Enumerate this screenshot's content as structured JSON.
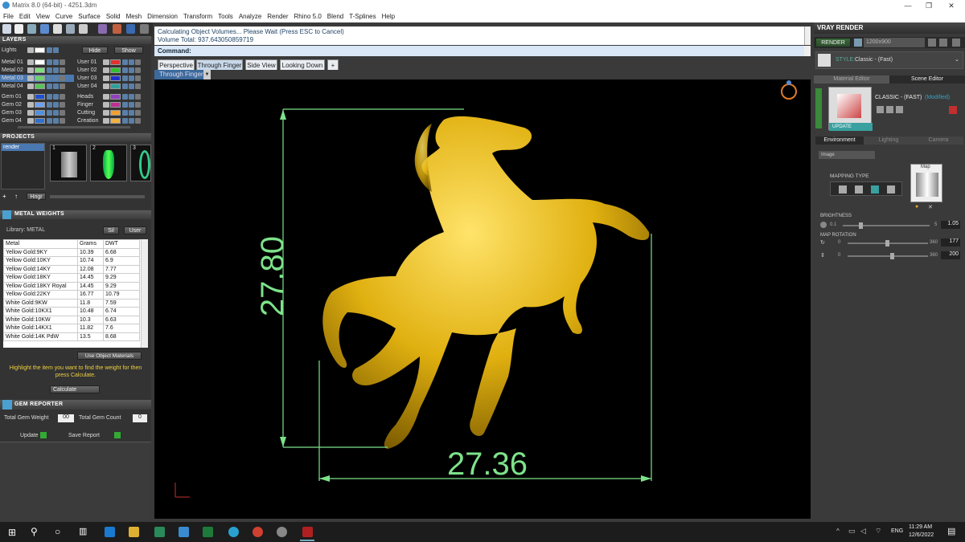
{
  "window": {
    "title": "Matrix 8.0 (64-bit) - 4251.3dm",
    "min": "—",
    "max": "❐",
    "close": "✕"
  },
  "menu": [
    "File",
    "Edit",
    "View",
    "Curve",
    "Surface",
    "Solid",
    "Mesh",
    "Dimension",
    "Transform",
    "Tools",
    "Analyze",
    "Render",
    "Rhino 5.0",
    "Blend",
    "T-Splines",
    "Help"
  ],
  "layers": {
    "title": "LAYERS",
    "lights_label": "Lights",
    "hide_label": "Hide",
    "show_label": "Show",
    "left": [
      {
        "name": "Metal 01",
        "color": "#ffffff"
      },
      {
        "name": "Metal 02",
        "color": "#7fe07f"
      },
      {
        "name": "Metal 03",
        "color": "#6fd06f"
      },
      {
        "name": "Metal 04",
        "color": "#59c459"
      },
      {
        "name": "Gem 01",
        "color": "#2050d0"
      },
      {
        "name": "Gem 02",
        "color": "#6fa0f0"
      },
      {
        "name": "Gem 03",
        "color": "#5090e0"
      },
      {
        "name": "Gem 04",
        "color": "#3070d0"
      }
    ],
    "right": [
      {
        "name": "User 01",
        "color": "#e03030"
      },
      {
        "name": "User 02",
        "color": "#30c030"
      },
      {
        "name": "User 03",
        "color": "#2030d0"
      },
      {
        "name": "User 04",
        "color": "#2fa0a0"
      },
      {
        "name": "Heads",
        "color": "#9040c0"
      },
      {
        "name": "Finger",
        "color": "#c03090"
      },
      {
        "name": "Cutting",
        "color": "#f0a030"
      },
      {
        "name": "Creation",
        "color": "#f0b040"
      }
    ]
  },
  "projects": {
    "title": "PROJECTS",
    "item": "render",
    "thumbs": [
      "1",
      "2",
      "3"
    ],
    "hngr": "Hngr"
  },
  "metal_weights": {
    "title": "METAL WEIGHTS",
    "library": "Library: METAL",
    "lib_btn1": "Sil",
    "lib_btn2": "User",
    "headers": [
      "Metal",
      "Grams",
      "DWT"
    ],
    "rows": [
      [
        "Yellow Gold:9KY",
        "10.39",
        "6.68"
      ],
      [
        "Yellow Gold:10KY",
        "10.74",
        "6.9"
      ],
      [
        "Yellow Gold:14KY",
        "12.08",
        "7.77"
      ],
      [
        "Yellow Gold:18KY",
        "14.45",
        "9.29"
      ],
      [
        "Yellow Gold:18KY Royal",
        "14.45",
        "9.29"
      ],
      [
        "Yellow Gold:22KY",
        "16.77",
        "10.79"
      ],
      [
        "White Gold:9KW",
        "11.8",
        "7.59"
      ],
      [
        "White Gold:10KX1",
        "10.48",
        "6.74"
      ],
      [
        "White Gold:10KW",
        "10.3",
        "6.63"
      ],
      [
        "White Gold:14KX1",
        "11.82",
        "7.6"
      ],
      [
        "White Gold:14K PdW",
        "13.5",
        "8.68"
      ]
    ],
    "use_object": "Use Object Materials",
    "hint": "Highlight the item you want to find the weight for then press Calculate.",
    "calculate": "Calculate"
  },
  "gem": {
    "title": "GEM REPORTER",
    "total_weight_label": "Total Gem Weight",
    "total_weight": "00",
    "total_count_label": "Total Gem Count",
    "total_count": "0",
    "update": "Update",
    "save_report": "Save Report"
  },
  "status": {
    "line1": "Calculating Object Volumes... Please Wait (Press ESC to Cancel)",
    "line2": "Volume Total: 937.643050859719"
  },
  "command": {
    "label": "Command:"
  },
  "view_tabs": [
    "Perspective",
    "Through Finger",
    "Side View",
    "Looking Down"
  ],
  "active_view": "Through Finger",
  "dimensions": {
    "height": "27.80",
    "width": "27.36"
  },
  "vray": {
    "title": "VRAY RENDER",
    "render_btn": "RENDER",
    "resolution": "1200x900",
    "style_label": "STYLE:",
    "style": "Classic - (Fast)",
    "tabs": [
      "Material Editor",
      "Scene Editor"
    ],
    "preset": "CLASSIC - (FAST)",
    "modified": "(Modified)",
    "update": "UPDATE",
    "sub_tabs": [
      "Environment",
      "Lighting",
      "Camera"
    ],
    "env_select": "Image",
    "mapping_type": "MAPPING TYPE",
    "map_label": "Map",
    "brightness_label": "BRIGHTNESS",
    "brightness_min": "0.1",
    "brightness_max": "5",
    "brightness": "1.05",
    "map_rotation_label": "MAP ROTATION",
    "rot1_min": "0",
    "rot1_max": "360",
    "rot1": "177",
    "rot2_min": "0",
    "rot2_max": "360",
    "rot2": "200"
  },
  "taskbar": {
    "time": "11:29 AM",
    "date": "12/6/2022",
    "lang": "ENG"
  }
}
